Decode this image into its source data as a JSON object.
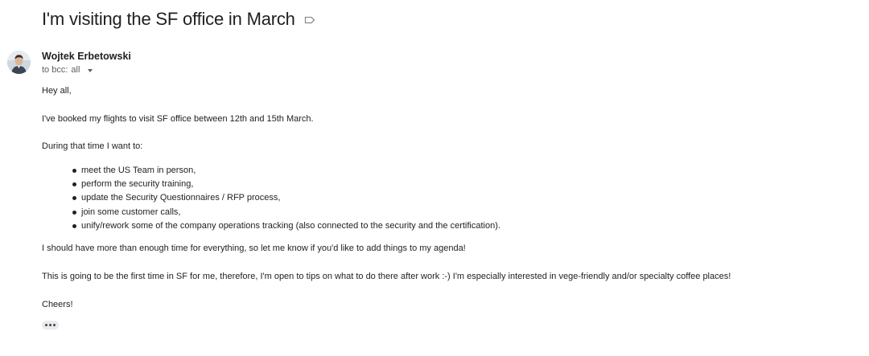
{
  "email": {
    "subject": "I'm visiting the SF office in March",
    "label_icon": "label-outline-icon",
    "sender": {
      "name": "Wojtek Erbetowski",
      "avatar_icon": "avatar-photo"
    },
    "recipients": {
      "prefix": "to bcc:",
      "value": "all",
      "toggle_icon": "caret-down-icon"
    },
    "body": {
      "greeting": "Hey all,",
      "booked": "I've booked my flights to visit SF office between 12th and 15th March.",
      "during": "During that time I want to:",
      "items": [
        "meet the US Team in person,",
        "perform the security training,",
        "update the Security Questionnaires / RFP process,",
        "join some customer calls,",
        "unify/rework some of the company operations tracking (also connected to the security and the certification)."
      ],
      "enough_time": "I should have more than enough time for everything, so let me know if you'd like to add things to my agenda!",
      "first_time": "This is going to be the first time in SF for me, therefore, I'm open to tips on what to do there after work :-) I'm especially interested in vege-friendly and/or specialty coffee places!",
      "signoff": "Cheers!"
    },
    "show_trimmed_icon": "more-horizontal-icon"
  }
}
